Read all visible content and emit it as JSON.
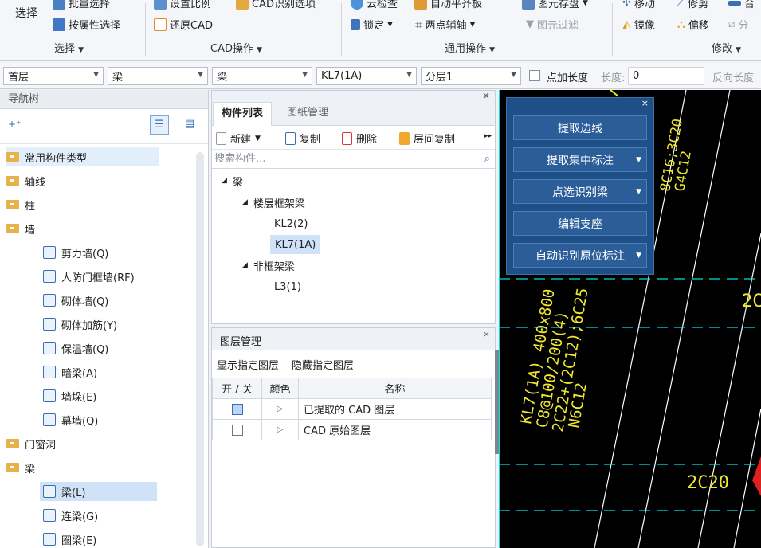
{
  "ribbon": {
    "select": {
      "big_label": "选择",
      "batch_select": "批量选择",
      "by_attr_select": "按属性选择",
      "group_label": "选择"
    },
    "cad_ops": {
      "set_scale": "设置比例",
      "cad_recognition_options": "CAD识别选项",
      "restore_cad": "还原CAD",
      "group_label": "CAD操作"
    },
    "common_ops": {
      "cloud_check": "云检查",
      "auto_flat_plate": "自动平齐板",
      "lock": "锁定",
      "two_point_aux_axis": "两点辅轴",
      "element_save": "图元存盘",
      "element_filter": "图元过滤",
      "group_label": "通用操作"
    },
    "modify": {
      "move": "移动",
      "trim": "修剪",
      "merge": "合",
      "mirror": "镜像",
      "offset": "偏移",
      "split": "分",
      "group_label": "修改"
    }
  },
  "combobar": {
    "floor": "首层",
    "category": "梁",
    "type": "梁",
    "component": "KL7(1A)",
    "sublayer": "分层1",
    "add_length_label": "点加长度",
    "length_label": "长度:",
    "length_value": "0",
    "reverse_length_label": "反向长度"
  },
  "nav": {
    "title": "导航树",
    "items": [
      {
        "label": "常用构件类型",
        "level": 0
      },
      {
        "label": "轴线",
        "level": 0
      },
      {
        "label": "柱",
        "level": 0
      },
      {
        "label": "墙",
        "level": 0
      },
      {
        "label": "剪力墙(Q)",
        "level": 1
      },
      {
        "label": "人防门框墙(RF)",
        "level": 1
      },
      {
        "label": "砌体墙(Q)",
        "level": 1
      },
      {
        "label": "砌体加筋(Y)",
        "level": 1
      },
      {
        "label": "保温墙(Q)",
        "level": 1
      },
      {
        "label": "暗梁(A)",
        "level": 1
      },
      {
        "label": "墙垛(E)",
        "level": 1
      },
      {
        "label": "幕墙(Q)",
        "level": 1
      },
      {
        "label": "门窗洞",
        "level": 0
      },
      {
        "label": "梁",
        "level": 0
      },
      {
        "label": "梁(L)",
        "level": 1
      },
      {
        "label": "连梁(G)",
        "level": 1
      },
      {
        "label": "圈梁(E)",
        "level": 1
      }
    ]
  },
  "complist": {
    "tab_components": "构件列表",
    "tab_drawings": "图纸管理",
    "new": "新建",
    "copy": "复制",
    "delete": "删除",
    "floor_copy": "层间复制",
    "search_placeholder": "搜索构件...",
    "tree": {
      "root": "梁",
      "group1": "楼层框架梁",
      "kl2": "KL2(2)",
      "kl7": "KL7(1A)",
      "group2": "非框架梁",
      "l3": "L3(1)"
    }
  },
  "layers": {
    "title": "图层管理",
    "show_specified": "显示指定图层",
    "hide_specified": "隐藏指定图层",
    "col_onoff": "开 / 关",
    "col_color": "颜色",
    "col_name": "名称",
    "rows": [
      {
        "name": "已提取的 CAD 图层",
        "checked": true
      },
      {
        "name": "CAD 原始图层",
        "checked": false
      }
    ]
  },
  "float_panel": {
    "extract_edge": "提取边线",
    "extract_centralized": "提取集中标注",
    "pick_identify_beam": "点选识别梁",
    "edit_support": "编辑支座",
    "auto_identify_original": "自动识别原位标注"
  },
  "cad_text": {
    "t1": "KL7(1A) 400x800",
    "t2": "C8@100/200(4)",
    "t3": "2C22+(2C12);6C25",
    "t4": "N6C12",
    "t5": "2C20",
    "t6": "2C",
    "t7": "8C16;3C20",
    "t8": "G4C12"
  }
}
